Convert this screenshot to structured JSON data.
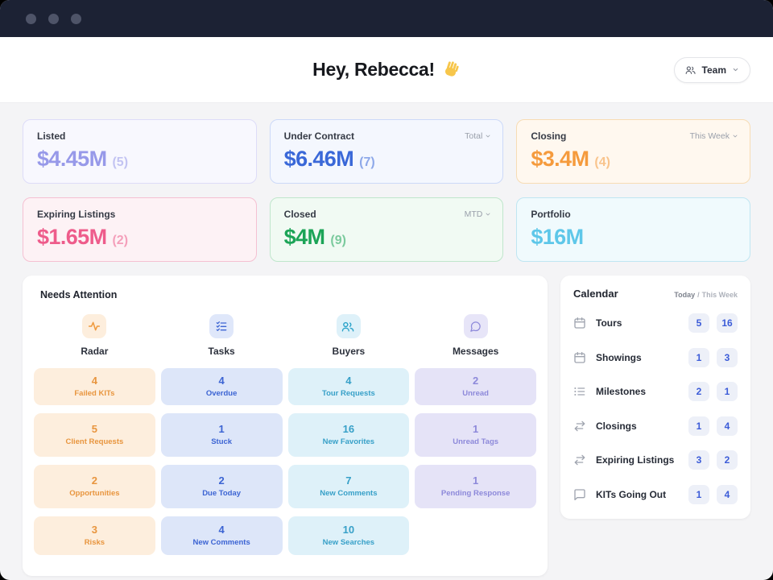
{
  "header": {
    "greeting": "Hey, Rebecca!",
    "wave_icon": "waving-hand-icon",
    "team_button": {
      "label": "Team",
      "icon": "team-icon"
    }
  },
  "stats": [
    {
      "label": "Listed",
      "value": "$4.45M",
      "count": "(5)",
      "theme": "purple",
      "color": "#9799e9"
    },
    {
      "label": "Under Contract",
      "value": "$6.46M",
      "count": "(7)",
      "filter": "Total",
      "theme": "blue",
      "color": "#3a68d8"
    },
    {
      "label": "Closing",
      "value": "$3.4M",
      "count": "(4)",
      "filter": "This Week",
      "theme": "orange",
      "color": "#f59b3d"
    },
    {
      "label": "Expiring Listings",
      "value": "$1.65M",
      "count": "(2)",
      "theme": "pink",
      "color": "#ee5c8b"
    },
    {
      "label": "Closed",
      "value": "$4M",
      "count": "(9)",
      "filter": "MTD",
      "theme": "green",
      "color": "#1ca457"
    },
    {
      "label": "Portfolio",
      "value": "$16M",
      "theme": "cyan",
      "color": "#5ec7e9"
    }
  ],
  "needs_attention": {
    "title": "Needs Attention",
    "columns": [
      {
        "name": "Radar",
        "icon": "radar-pulse-icon",
        "theme": "orange",
        "tiles": [
          {
            "count": "4",
            "label": "Failed KITs"
          },
          {
            "count": "5",
            "label": "Client Requests"
          },
          {
            "count": "2",
            "label": "Opportunities"
          },
          {
            "count": "3",
            "label": "Risks"
          }
        ]
      },
      {
        "name": "Tasks",
        "icon": "tasks-checklist-icon",
        "theme": "blue",
        "tiles": [
          {
            "count": "4",
            "label": "Overdue"
          },
          {
            "count": "1",
            "label": "Stuck"
          },
          {
            "count": "2",
            "label": "Due Today"
          },
          {
            "count": "4",
            "label": "New Comments"
          }
        ]
      },
      {
        "name": "Buyers",
        "icon": "buyers-people-icon",
        "theme": "cyan",
        "tiles": [
          {
            "count": "4",
            "label": "Tour Requests"
          },
          {
            "count": "16",
            "label": "New Favorites"
          },
          {
            "count": "7",
            "label": "New Comments"
          },
          {
            "count": "10",
            "label": "New Searches"
          }
        ]
      },
      {
        "name": "Messages",
        "icon": "messages-chat-icon",
        "theme": "violet",
        "tiles": [
          {
            "count": "2",
            "label": "Unread"
          },
          {
            "count": "1",
            "label": "Unread Tags"
          },
          {
            "count": "1",
            "label": "Pending Response"
          }
        ]
      }
    ]
  },
  "calendar": {
    "title": "Calendar",
    "today_label": "Today",
    "separator": "/",
    "week_label": "This Week",
    "rows": [
      {
        "label": "Tours",
        "icon": "calendar-icon",
        "today": "5",
        "week": "16"
      },
      {
        "label": "Showings",
        "icon": "calendar-icon",
        "today": "1",
        "week": "3"
      },
      {
        "label": "Milestones",
        "icon": "milestones-list-icon",
        "today": "2",
        "week": "1"
      },
      {
        "label": "Closings",
        "icon": "swap-arrows-icon",
        "today": "1",
        "week": "4"
      },
      {
        "label": "Expiring Listings",
        "icon": "swap-arrows-icon",
        "today": "3",
        "week": "2"
      },
      {
        "label": "KITs Going Out",
        "icon": "outgoing-message-icon",
        "today": "1",
        "week": "4"
      }
    ]
  },
  "colors": {
    "titlebar": "#1c2234",
    "accent_purple": "#9799e9",
    "accent_blue": "#3a68d8",
    "accent_orange": "#f59b3d",
    "accent_pink": "#ee5c8b",
    "accent_green": "#1ca457",
    "accent_cyan": "#5ec7e9",
    "badge_text": "#3c5cd8"
  }
}
